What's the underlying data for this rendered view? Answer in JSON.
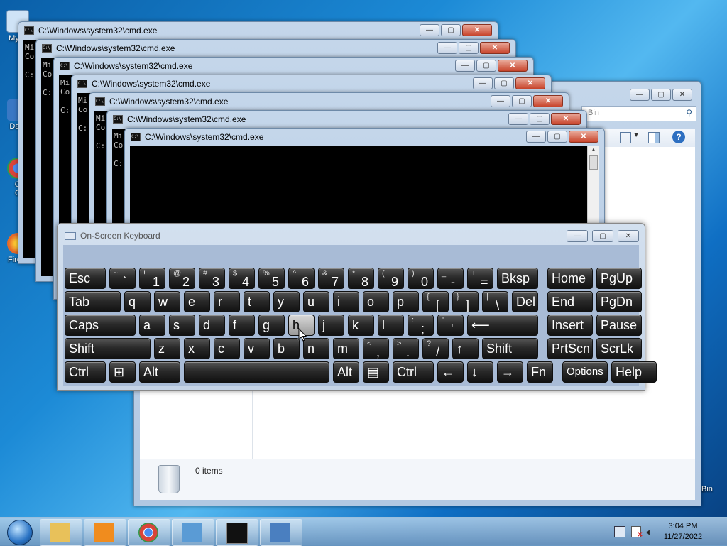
{
  "desktop": {
    "icons": [
      {
        "label": "My C",
        "color": "#4e86c6"
      },
      {
        "label": "Data",
        "color": "#3a78c4"
      },
      {
        "label": "G\nC",
        "color": "#d9443a"
      },
      {
        "label": "Firefo",
        "color": "#e56a2a"
      }
    ],
    "recycle_label": "Bin"
  },
  "cmd": {
    "title": "C:\\Windows\\system32\\cmd.exe",
    "line1": "Mi",
    "line2": "Co",
    "prompt": "C:",
    "close_glyph": "✕",
    "min_glyph": "—",
    "max_glyph": "▢"
  },
  "explorer": {
    "search_placeholder": "Bin",
    "items_count": "0 items"
  },
  "osk": {
    "title": "On-Screen Keyboard",
    "hover_key": "h"
  },
  "keyboard": {
    "rows": [
      [
        {
          "id": "esc",
          "label": "Esc",
          "w": 58
        },
        {
          "id": "backtick",
          "shift": "~",
          "base": "`",
          "w": 37
        },
        {
          "id": "k1",
          "shift": "!",
          "base": "1",
          "w": 37
        },
        {
          "id": "k2",
          "shift": "@",
          "base": "2",
          "w": 37
        },
        {
          "id": "k3",
          "shift": "#",
          "base": "3",
          "w": 37
        },
        {
          "id": "k4",
          "shift": "$",
          "base": "4",
          "w": 37
        },
        {
          "id": "k5",
          "shift": "%",
          "base": "5",
          "w": 37
        },
        {
          "id": "k6",
          "shift": "^",
          "base": "6",
          "w": 37
        },
        {
          "id": "k7",
          "shift": "&",
          "base": "7",
          "w": 37
        },
        {
          "id": "k8",
          "shift": "*",
          "base": "8",
          "w": 37
        },
        {
          "id": "k9",
          "shift": "(",
          "base": "9",
          "w": 37
        },
        {
          "id": "k0",
          "shift": ")",
          "base": "0",
          "w": 37
        },
        {
          "id": "minus",
          "shift": "_",
          "base": "-",
          "w": 37
        },
        {
          "id": "equals",
          "shift": "+",
          "base": "=",
          "w": 37
        },
        {
          "id": "bksp",
          "label": "Bksp",
          "w": 58
        },
        {
          "id": "home",
          "label": "Home",
          "w": 64,
          "gap": 8
        },
        {
          "id": "pgup",
          "label": "PgUp",
          "w": 64
        }
      ],
      [
        {
          "id": "tab",
          "label": "Tab",
          "w": 79
        },
        {
          "id": "q",
          "label": "q",
          "w": 37
        },
        {
          "id": "w",
          "label": "w",
          "w": 37
        },
        {
          "id": "e",
          "label": "e",
          "w": 37
        },
        {
          "id": "r",
          "label": "r",
          "w": 37
        },
        {
          "id": "t",
          "label": "t",
          "w": 37
        },
        {
          "id": "y",
          "label": "y",
          "w": 37
        },
        {
          "id": "u",
          "label": "u",
          "w": 37
        },
        {
          "id": "i",
          "label": "i",
          "w": 37
        },
        {
          "id": "o",
          "label": "o",
          "w": 37
        },
        {
          "id": "p",
          "label": "p",
          "w": 37
        },
        {
          "id": "lbracket",
          "shift": "{",
          "base": "[",
          "w": 37
        },
        {
          "id": "rbracket",
          "shift": "}",
          "base": "]",
          "w": 37
        },
        {
          "id": "backslash",
          "shift": "|",
          "base": "\\",
          "w": 37
        },
        {
          "id": "del",
          "label": "Del",
          "w": 37
        },
        {
          "id": "end",
          "label": "End",
          "w": 64,
          "gap": 8
        },
        {
          "id": "pgdn",
          "label": "PgDn",
          "w": 64
        }
      ],
      [
        {
          "id": "caps",
          "label": "Caps",
          "w": 100
        },
        {
          "id": "a",
          "label": "a",
          "w": 37
        },
        {
          "id": "s",
          "label": "s",
          "w": 37
        },
        {
          "id": "d",
          "label": "d",
          "w": 37
        },
        {
          "id": "f",
          "label": "f",
          "w": 37
        },
        {
          "id": "g",
          "label": "g",
          "w": 37
        },
        {
          "id": "h",
          "label": "h",
          "w": 37
        },
        {
          "id": "j",
          "label": "j",
          "w": 37
        },
        {
          "id": "k",
          "label": "k",
          "w": 37
        },
        {
          "id": "l",
          "label": "l",
          "w": 37
        },
        {
          "id": "semicolon",
          "shift": ":",
          "base": ";",
          "w": 37
        },
        {
          "id": "quote",
          "shift": "\"",
          "base": "'",
          "w": 37
        },
        {
          "id": "enter",
          "label": "⟵",
          "w": 100
        },
        {
          "id": "insert",
          "label": "Insert",
          "w": 64,
          "gap": 8
        },
        {
          "id": "pause",
          "label": "Pause",
          "w": 64
        }
      ],
      [
        {
          "id": "lshift",
          "label": "Shift",
          "w": 121
        },
        {
          "id": "z",
          "label": "z",
          "w": 37
        },
        {
          "id": "x",
          "label": "x",
          "w": 37
        },
        {
          "id": "c",
          "label": "c",
          "w": 37
        },
        {
          "id": "v",
          "label": "v",
          "w": 37
        },
        {
          "id": "b",
          "label": "b",
          "w": 37
        },
        {
          "id": "n",
          "label": "n",
          "w": 37
        },
        {
          "id": "m",
          "label": "m",
          "w": 37
        },
        {
          "id": "comma",
          "shift": "<",
          "base": ",",
          "w": 37
        },
        {
          "id": "period",
          "shift": ">",
          "base": ".",
          "w": 37
        },
        {
          "id": "slash",
          "shift": "?",
          "base": "/",
          "w": 37
        },
        {
          "id": "up",
          "label": "↑",
          "w": 37
        },
        {
          "id": "rshift",
          "label": "Shift",
          "w": 79
        },
        {
          "id": "prtscn",
          "label": "PrtScn",
          "w": 64,
          "gap": 8
        },
        {
          "id": "scrlk",
          "label": "ScrLk",
          "w": 64
        }
      ],
      [
        {
          "id": "lctrl",
          "label": "Ctrl",
          "w": 58
        },
        {
          "id": "win",
          "label": "⊞",
          "w": 37
        },
        {
          "id": "lalt",
          "label": "Alt",
          "w": 58
        },
        {
          "id": "space",
          "label": "",
          "w": 205
        },
        {
          "id": "ralt",
          "label": "Alt",
          "w": 37
        },
        {
          "id": "menu",
          "label": "▤",
          "w": 37
        },
        {
          "id": "rctrl",
          "label": "Ctrl",
          "w": 58
        },
        {
          "id": "left",
          "label": "←",
          "w": 37
        },
        {
          "id": "down",
          "label": "↓",
          "w": 37
        },
        {
          "id": "right",
          "label": "→",
          "w": 37
        },
        {
          "id": "fn",
          "label": "Fn",
          "w": 37
        },
        {
          "id": "options",
          "label": "Options",
          "w": 64,
          "gap": 8,
          "small": true
        },
        {
          "id": "help",
          "label": "Help",
          "w": 64
        }
      ]
    ]
  },
  "taskbar": {
    "apps": [
      {
        "name": "explorer",
        "color": "#e8c15a"
      },
      {
        "name": "media-player",
        "color": "#f08c1e"
      },
      {
        "name": "chrome",
        "color": "#d9443a"
      },
      {
        "name": "network",
        "color": "#5a9bd5"
      },
      {
        "name": "cmd",
        "color": "#111111"
      },
      {
        "name": "osk",
        "color": "#4a7fc0"
      }
    ],
    "time": "3:04 PM",
    "date": "11/27/2022"
  }
}
